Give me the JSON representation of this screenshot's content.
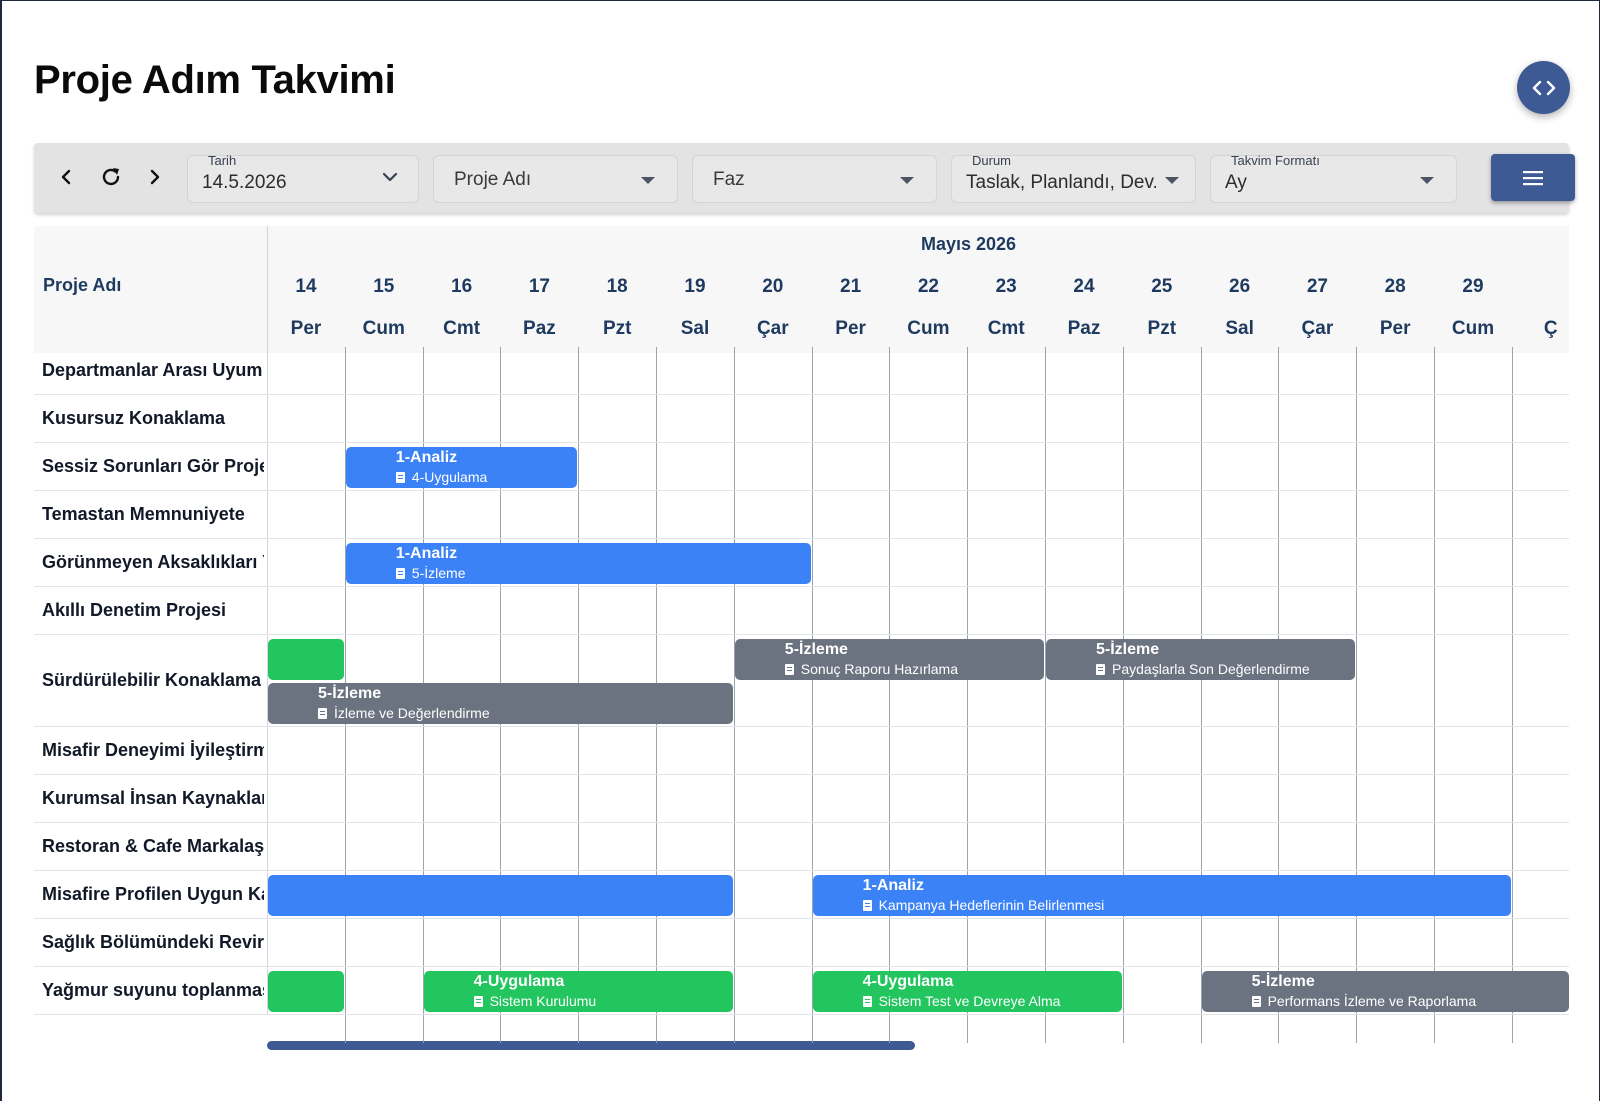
{
  "page": {
    "title": "Proje Adım Takvimi"
  },
  "toolbar": {
    "date_label": "Tarih",
    "date_value": "14.5.2026",
    "project_placeholder": "Proje Adı",
    "phase_placeholder": "Faz",
    "status_label": "Durum",
    "status_value": "Taslak, Planlandı, Dev...",
    "format_label": "Takvim Formatı",
    "format_value": "Ay"
  },
  "calendar": {
    "month": "Mayıs 2026",
    "project_column": "Proje Adı",
    "days": [
      {
        "num": "14",
        "name": "Per"
      },
      {
        "num": "15",
        "name": "Cum"
      },
      {
        "num": "16",
        "name": "Cmt"
      },
      {
        "num": "17",
        "name": "Paz"
      },
      {
        "num": "18",
        "name": "Pzt"
      },
      {
        "num": "19",
        "name": "Sal"
      },
      {
        "num": "20",
        "name": "Çar"
      },
      {
        "num": "21",
        "name": "Per"
      },
      {
        "num": "22",
        "name": "Cum"
      },
      {
        "num": "23",
        "name": "Cmt"
      },
      {
        "num": "24",
        "name": "Paz"
      },
      {
        "num": "25",
        "name": "Pzt"
      },
      {
        "num": "26",
        "name": "Sal"
      },
      {
        "num": "27",
        "name": "Çar"
      },
      {
        "num": "28",
        "name": "Per"
      },
      {
        "num": "29",
        "name": "Cum"
      },
      {
        "num": "",
        "name": "Ç"
      }
    ],
    "rows": [
      "Departmanlar Arası Uyum P",
      "Kusursuz Konaklama",
      "Sessiz Sorunları Gör Projes",
      "Temastan Memnuniyete",
      "Görünmeyen Aksaklıkları Ya",
      "Akıllı Denetim Projesi",
      "Sürdürülebilir Konaklama P",
      "Misafir Deneyimi İyileştirme",
      "Kurumsal İnsan Kaynakları",
      "Restoran & Cafe Markalaşm",
      "Misafire Profilen Uygun Kar",
      "Sağlık Bölümündeki Revirin",
      "Yağmur suyunu toplanması"
    ],
    "events": [
      {
        "row": 2,
        "start": 1,
        "span": 3,
        "color": "blue",
        "title": "1-Analiz",
        "subtitle": "4-Uygulama"
      },
      {
        "row": 4,
        "start": 1,
        "span": 6,
        "color": "blue",
        "title": "1-Analiz",
        "subtitle": "5-İzleme"
      },
      {
        "row": 6,
        "start": 0,
        "span": 1,
        "color": "green",
        "title": "",
        "subtitle": ""
      },
      {
        "row": 6,
        "start": 6,
        "span": 4,
        "color": "gray",
        "title": "5-İzleme",
        "subtitle": "Sonuç Raporu Hazırlama"
      },
      {
        "row": 6,
        "start": 10,
        "span": 4,
        "color": "gray",
        "title": "5-İzleme",
        "subtitle": "Paydaşlarla Son Değerlendirme"
      },
      {
        "row": 6,
        "start": 0,
        "span": 6,
        "color": "gray",
        "lane": 1,
        "title": "5-İzleme",
        "subtitle": "İzleme ve Değerlendirme"
      },
      {
        "row": 10,
        "start": 0,
        "span": 6,
        "color": "blue",
        "title": "",
        "subtitle": ""
      },
      {
        "row": 10,
        "start": 7,
        "span": 9,
        "color": "blue",
        "title": "1-Analiz",
        "subtitle": "Kampanya Hedeflerinin Belirlenmesi"
      },
      {
        "row": 12,
        "start": 0,
        "span": 1,
        "color": "green",
        "title": "",
        "subtitle": ""
      },
      {
        "row": 12,
        "start": 2,
        "span": 4,
        "color": "green",
        "title": "4-Uygulama",
        "subtitle": "Sistem Kurulumu"
      },
      {
        "row": 12,
        "start": 7,
        "span": 4,
        "color": "green",
        "title": "4-Uygulama",
        "subtitle": "Sistem Test ve Devreye Alma"
      },
      {
        "row": 12,
        "start": 12,
        "span": 5,
        "color": "gray",
        "title": "5-İzleme",
        "subtitle": "Performans İzleme ve Raporlama"
      }
    ]
  },
  "scroll": {
    "horizontal_position": 0
  },
  "colors": {
    "blue": "#3b82f6",
    "green": "#22c55e",
    "gray": "#6b7280",
    "accent": "#3d5a94"
  },
  "icons": [
    "code-icon",
    "chevron-left-icon",
    "refresh-icon",
    "chevron-right-icon",
    "chevron-down-icon",
    "caret-down-icon",
    "menu-icon",
    "document-icon"
  ]
}
